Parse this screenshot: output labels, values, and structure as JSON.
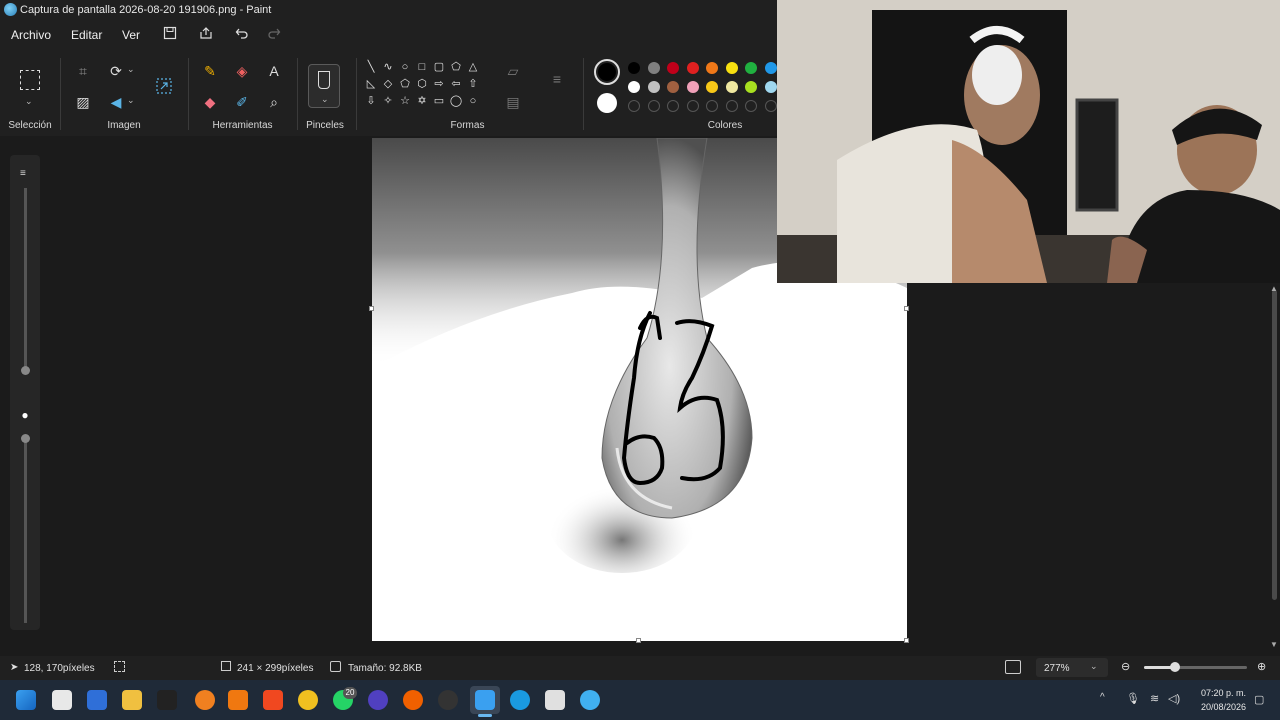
{
  "window": {
    "title": "Captura de pantalla 2026-08-20 191906.png - Paint"
  },
  "menu": {
    "file": "Archivo",
    "edit": "Editar",
    "view": "Ver"
  },
  "ribbon": {
    "groups": {
      "selection": "Selección",
      "image": "Imagen",
      "tools": "Herramientas",
      "brushes": "Pinceles",
      "shapes": "Formas",
      "colors": "Colores"
    }
  },
  "colors": {
    "primary": "#000000",
    "secondary": "#ffffff",
    "row1": [
      "#000000",
      "#808080",
      "#c0001a",
      "#e02020",
      "#f07818",
      "#f8e010",
      "#20b040",
      "#2098e8"
    ],
    "row2": [
      "#ffffff",
      "#c0c0c0",
      "#a06040",
      "#f0a0b8",
      "#f8c818",
      "#f0e8a0",
      "#a8e020",
      "#a0d8f0"
    ]
  },
  "status": {
    "cursor_pos": "128, 170píxeles",
    "selection_size": "",
    "canvas_size": "241 × 299píxeles",
    "file_size": "Tamaño: 92.8KB",
    "zoom": "277%"
  },
  "taskbar": {
    "clock_time": "07:20 p. m.",
    "clock_date": "20/08/2026",
    "whatsapp_badge": "20"
  }
}
